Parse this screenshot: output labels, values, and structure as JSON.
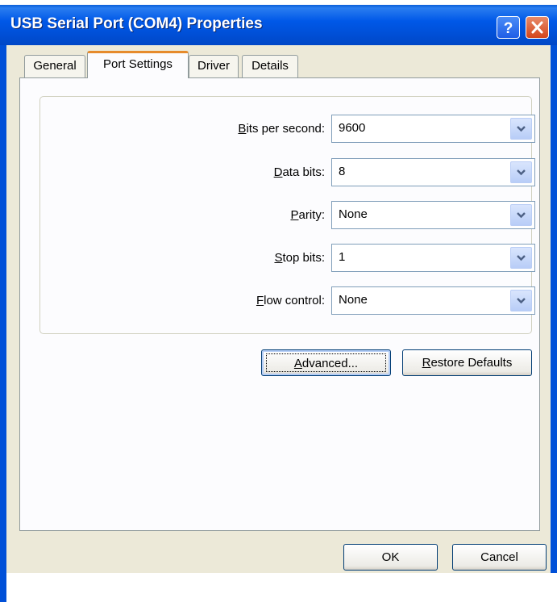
{
  "window": {
    "title": "USB Serial Port (COM4) Properties",
    "help_label": "?",
    "close_label": "X"
  },
  "tabs": [
    {
      "label": "General"
    },
    {
      "label": "Port Settings",
      "active": true
    },
    {
      "label": "Driver"
    },
    {
      "label": "Details"
    }
  ],
  "settings": [
    {
      "label": "Bits per second:",
      "mnemonic": "B",
      "rest": "its per second:",
      "value": "9600"
    },
    {
      "label": "Data bits:",
      "mnemonic": "D",
      "rest": "ata bits:",
      "value": "8"
    },
    {
      "label": "Parity:",
      "mnemonic": "P",
      "rest": "arity:",
      "value": "None"
    },
    {
      "label": "Stop bits:",
      "mnemonic": "S",
      "rest": "top bits:",
      "value": "1"
    },
    {
      "label": "Flow control:",
      "mnemonic": "F",
      "rest": "low control:",
      "value": "None"
    }
  ],
  "buttons": {
    "advanced": {
      "label": "Advanced...",
      "mnemonic": "A",
      "rest": "dvanced..."
    },
    "restore": {
      "label": "Restore Defaults",
      "mnemonic": "R",
      "rest": "estore Defaults"
    },
    "ok": "OK",
    "cancel": "Cancel"
  },
  "colors": {
    "titlebar": "#0050d8",
    "face": "#ece9d8",
    "active_tab_accent": "#e68b2c"
  }
}
